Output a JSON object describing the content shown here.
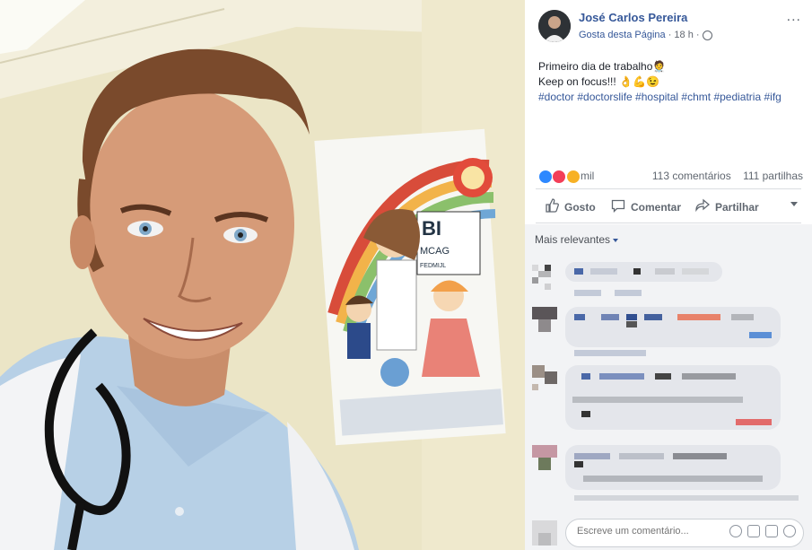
{
  "post": {
    "author": "José Carlos Pereira",
    "like_page": "Gosta desta Página",
    "time": "18 h",
    "more_icon": "...",
    "text_line1": "Primeiro dia de trabalho🧑‍⚕️",
    "text_line2": "Keep on focus!!! 👌💪😉",
    "hashtags": "#doctor #doctorslife #hospital #chmt #pediatria #ifg"
  },
  "photo": {
    "poster_letters_1": "BI",
    "poster_letters_2": "MCAG",
    "poster_letters_3": "FEDMIJL"
  },
  "stats": {
    "reactions_count": "mil",
    "comments": "113 comentários",
    "shares": "111 partilhas"
  },
  "actions": {
    "like": "Gosto",
    "comment": "Comentar",
    "share": "Partilhar"
  },
  "comments": {
    "sort_label": "Mais relevantes",
    "placeholder": "Escreve um comentário..."
  },
  "colors": {
    "link": "#365899",
    "meta": "#606770",
    "like_blue": "#2d88ff",
    "love_red": "#f33e58",
    "haha_yellow": "#f7b125"
  }
}
